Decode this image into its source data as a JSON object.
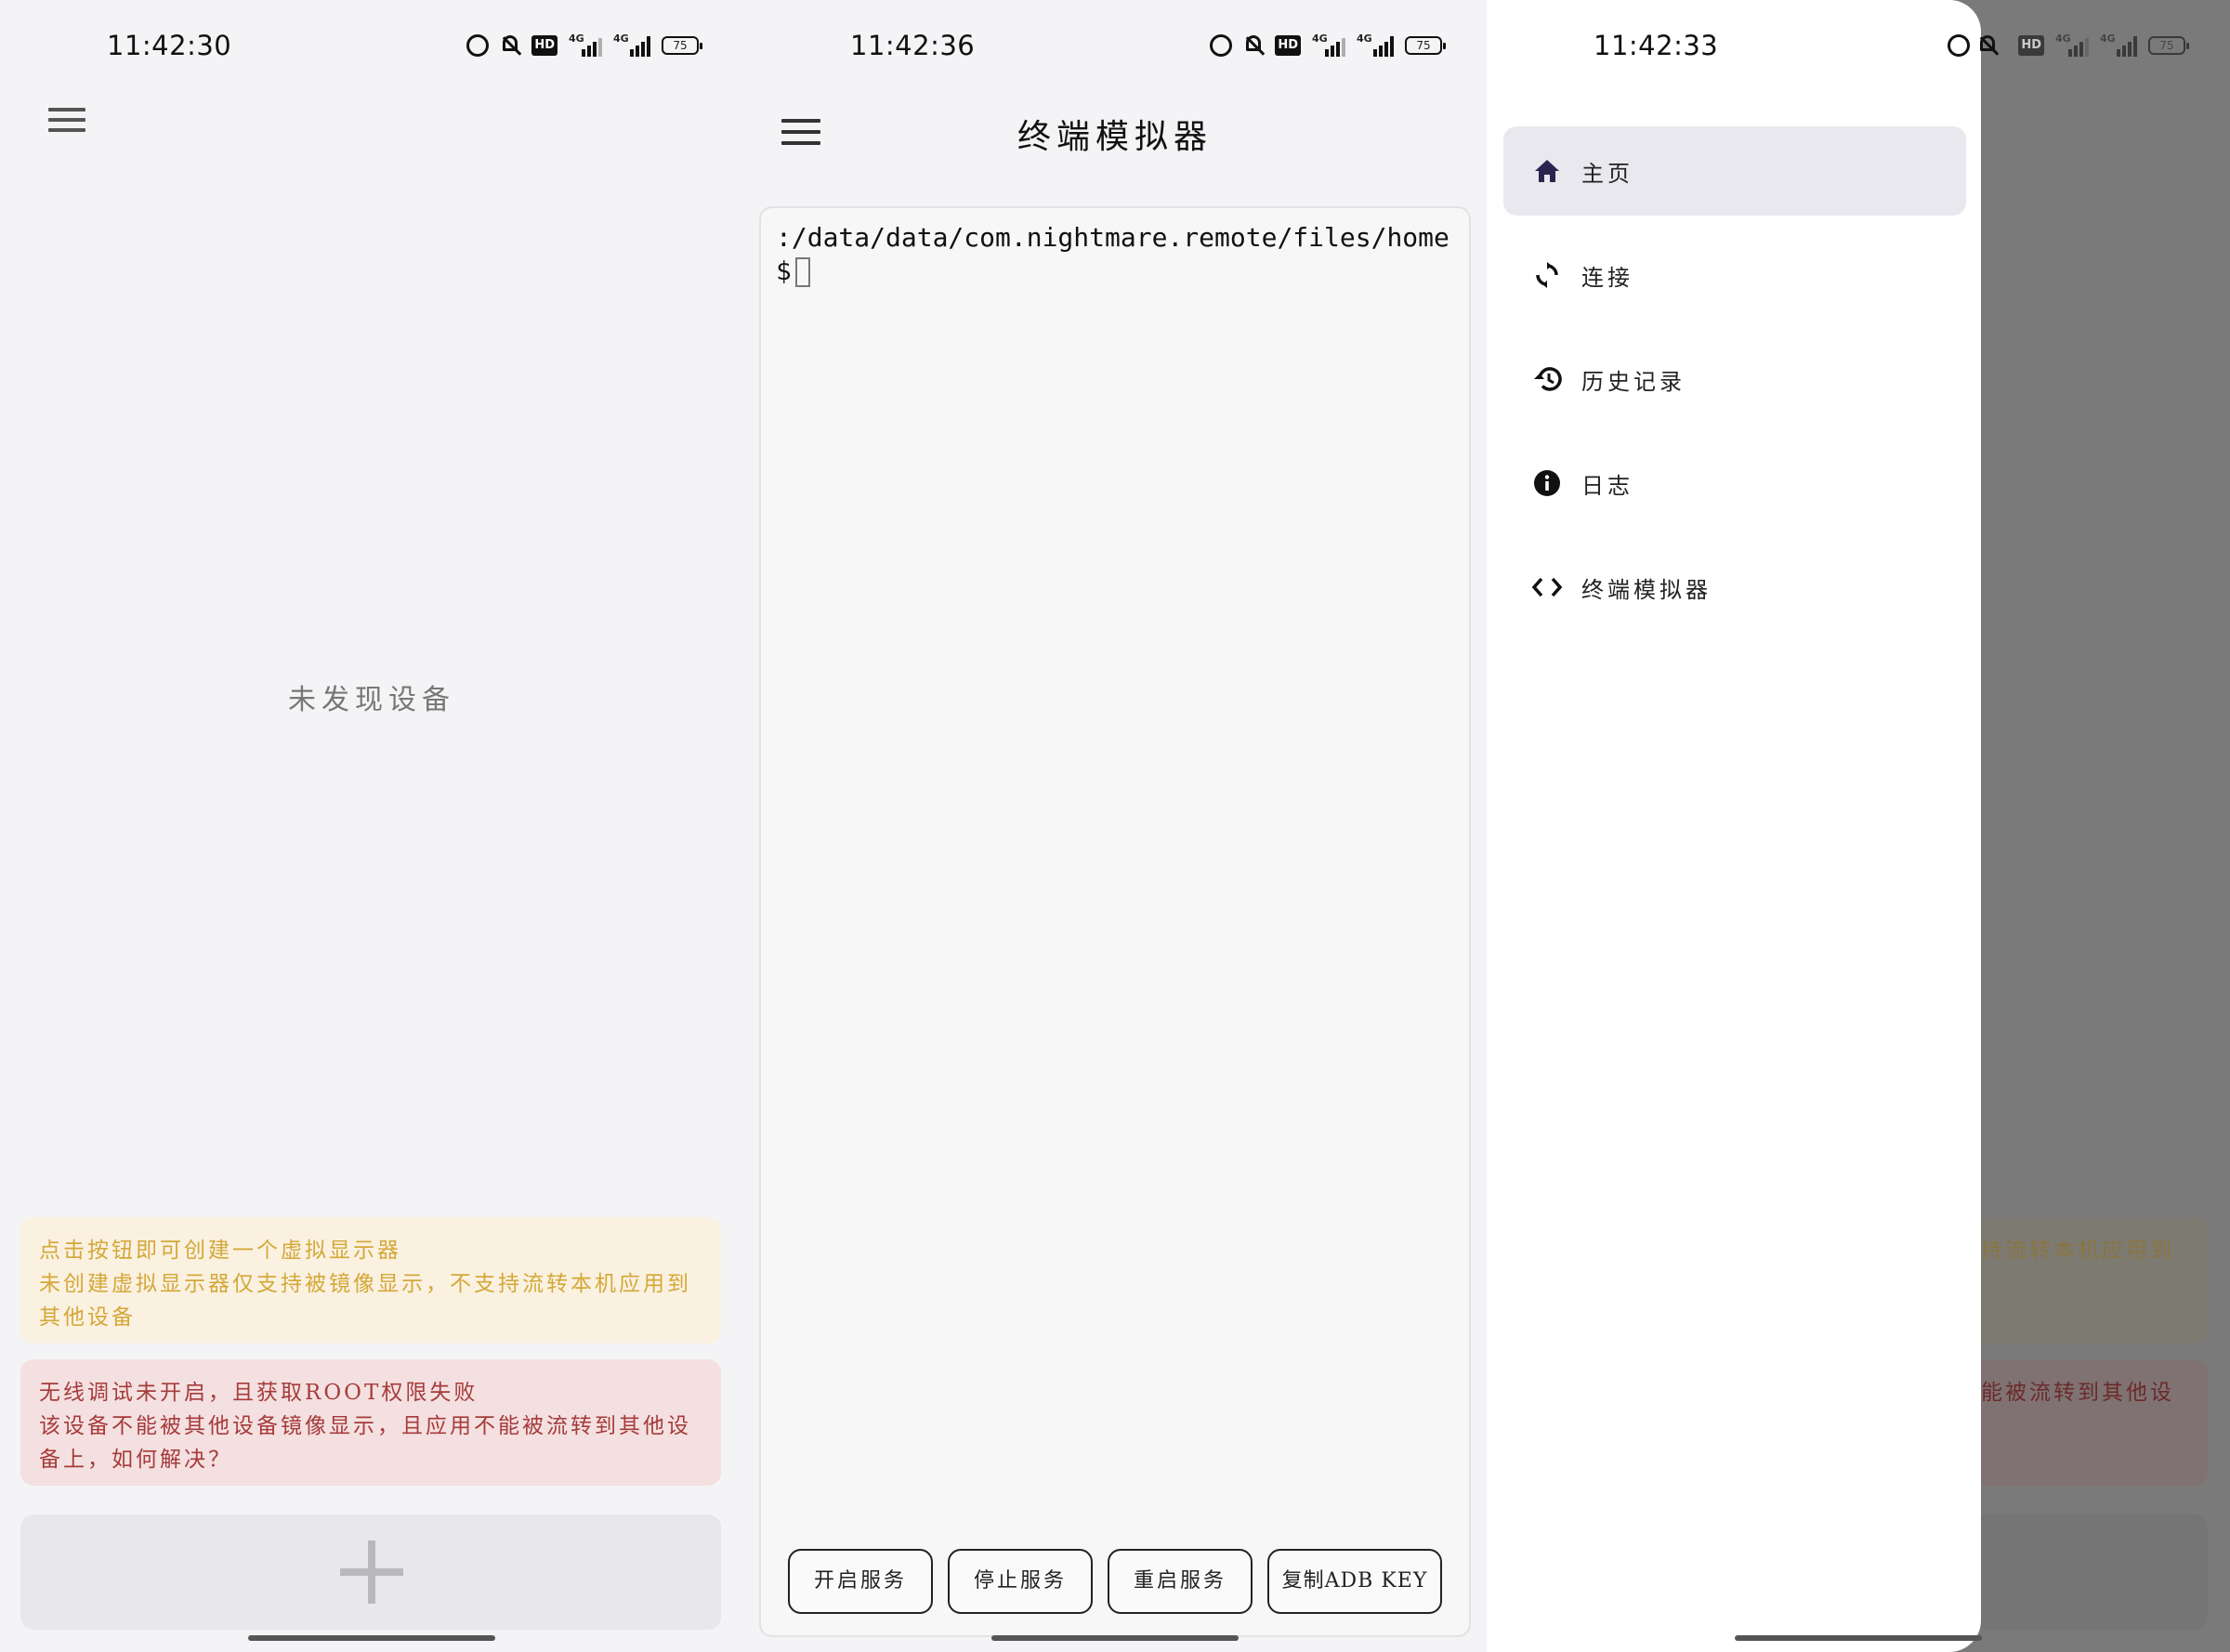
{
  "screens": {
    "left": {
      "time": "11:42:30",
      "battery": "75",
      "empty_text": "未发现设备",
      "notice_yellow_line1": "点击按钮即可创建一个虚拟显示器",
      "notice_yellow_line2": "未创建虚拟显示器仅支持被镜像显示，不支持流转本机应用到",
      "notice_yellow_line3": "其他设备",
      "notice_red_line1": "无线调试未开启，且获取ROOT权限失败",
      "notice_red_line2": "该设备不能被其他设备镜像显示，且应用不能被流转到其他设",
      "notice_red_line3": "备上，如何解决？"
    },
    "middle": {
      "time": "11:42:36",
      "battery": "75",
      "title": "终端模拟器",
      "terminal_text": ":/data/data/com.nightmare.remote/files/home $",
      "buttons": [
        "开启服务",
        "停止服务",
        "重启服务",
        "复制ADB KEY"
      ]
    },
    "right": {
      "time": "11:42:33",
      "battery": "75",
      "menu": [
        {
          "label": "主页",
          "icon": "home-icon"
        },
        {
          "label": "连接",
          "icon": "sync-icon"
        },
        {
          "label": "历史记录",
          "icon": "history-icon"
        },
        {
          "label": "日志",
          "icon": "info-icon"
        },
        {
          "label": "终端模拟器",
          "icon": "code-icon"
        }
      ],
      "dim_yellow_text": "持流转本机应用到",
      "dim_red_text": "能被流转到其他设"
    }
  },
  "colors": {
    "notice_yellow_bg": "#faf1e1",
    "notice_yellow_text": "#d4a838",
    "notice_red_bg": "#f4e0e0",
    "notice_red_text": "#a63b3b",
    "drawer_active": "#e9e8ee",
    "home_icon": "#2a2550"
  }
}
